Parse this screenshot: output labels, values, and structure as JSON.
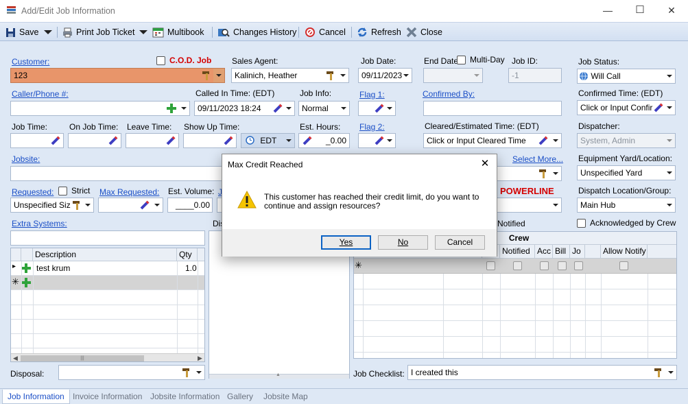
{
  "window": {
    "title": "Add/Edit Job Information",
    "minimize": "—",
    "maximize": "☐",
    "close": "✕"
  },
  "toolbar": {
    "save": "Save",
    "print": "Print Job Ticket",
    "multibook": "Multibook",
    "changes": "Changes History",
    "cancel": "Cancel",
    "refresh": "Refresh",
    "close": "Close"
  },
  "colors": {
    "accent": "#1a4ec6",
    "customer_highlight": "#e8956a",
    "alert_red": "#d40000",
    "form_bg": "#dee8f5"
  },
  "fields": {
    "customer": {
      "label": "Customer:",
      "value": "123"
    },
    "cod": {
      "label": "C.O.D. Job",
      "checked": false
    },
    "sales_agent": {
      "label": "Sales Agent:",
      "value": "Kalinich, Heather"
    },
    "job_date": {
      "label": "Job Date:",
      "value": "09/11/2023"
    },
    "end_date": {
      "label": "End Date:",
      "value": ""
    },
    "multi_day": {
      "label": "Multi-Day",
      "checked": false
    },
    "job_id": {
      "label": "Job ID:",
      "value": "-1"
    },
    "job_status": {
      "label": "Job Status:",
      "value": "Will Call"
    },
    "caller_phone": {
      "label": "Caller/Phone #:",
      "value": ""
    },
    "called_in": {
      "label": "Called In Time: (EDT)",
      "value": "09/11/2023 18:24"
    },
    "job_info": {
      "label": "Job Info:",
      "value": "Normal"
    },
    "flag1": {
      "label": "Flag 1:"
    },
    "confirmed_by": {
      "label": "Confirmed By:",
      "value": ""
    },
    "confirmed_time": {
      "label": "Confirmed Time: (EDT)",
      "value": "Click or Input Confir"
    },
    "job_time": {
      "label": "Job Time:"
    },
    "on_job_time": {
      "label": "On Job Time:"
    },
    "leave_time": {
      "label": "Leave Time:"
    },
    "show_up_time": {
      "label": "Show Up Time:"
    },
    "tz": {
      "value": "EDT"
    },
    "est_hours": {
      "label": "Est. Hours:",
      "value": "_0.00"
    },
    "flag2": {
      "label": "Flag 2:"
    },
    "cleared_time": {
      "label": "Cleared/Estimated Time: (EDT)",
      "value": "Click or Input Cleared Time"
    },
    "dispatcher": {
      "label": "Dispatcher:",
      "value": "System, Admin"
    },
    "jobsite": {
      "label": "Jobsite:",
      "value": ""
    },
    "select_more": {
      "label": "Select More..."
    },
    "equipment_yard": {
      "label": "Equipment Yard/Location:",
      "value": "Unspecified Yard"
    },
    "requested": {
      "label": "Requested:",
      "value": "Unspecified Siz"
    },
    "strict": {
      "label": "Strict",
      "checked": false
    },
    "max_requested": {
      "label": "Max Requested:"
    },
    "est_volume": {
      "label": "Est. Volume:",
      "value": "____0.00"
    },
    "powerline": {
      "label": "POWERLINE"
    },
    "dispatch_location": {
      "label": "Dispatch Location/Group:",
      "value": "Main Hub"
    },
    "extra_systems": {
      "label": "Extra Systems:",
      "value": ""
    },
    "dis_partial": {
      "label": "Dis"
    },
    "notified_partial": {
      "label": "Notified"
    },
    "acknowledged": {
      "label": "Acknowledged by Crew",
      "checked": false
    },
    "disposal": {
      "label": "Disposal:",
      "value": ""
    },
    "job_checklist": {
      "label": "Job Checklist:",
      "value": "I created this"
    }
  },
  "items_grid": {
    "columns": [
      "Description",
      "Qty"
    ],
    "rows": [
      {
        "description": "test krum",
        "qty": "1.0"
      }
    ],
    "scroll_grip": "|||"
  },
  "crew_grid": {
    "title": "Crew",
    "columns": [
      "Notified",
      "Acc",
      "Bill",
      "Jo",
      "Allow Notify"
    ],
    "new_row_marker": "✳"
  },
  "tabs": [
    "Job Information",
    "Invoice Information",
    "Jobsite Information",
    "Gallery",
    "Jobsite Map"
  ],
  "dialog": {
    "title": "Max Credit Reached",
    "message_line1": "This customer has reached their credit limit, do you want to",
    "message_line2": "continue and assign resources?",
    "yes": "Yes",
    "no": "No",
    "cancel": "Cancel"
  }
}
